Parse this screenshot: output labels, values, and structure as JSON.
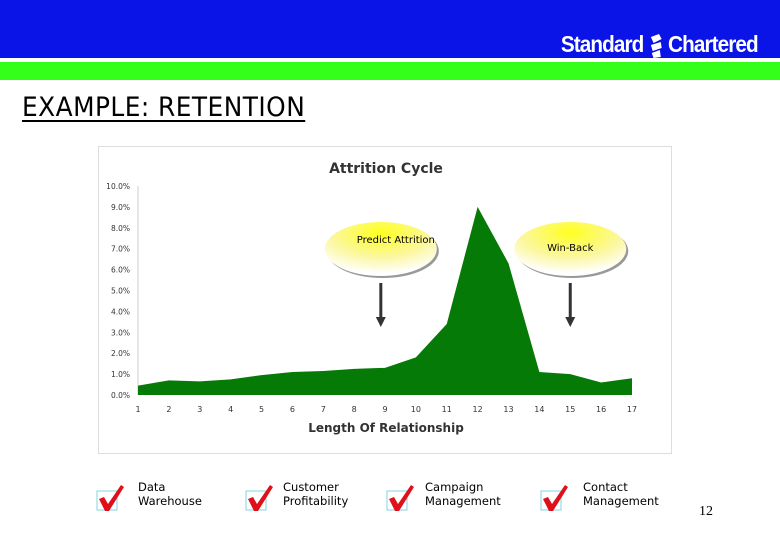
{
  "header": {
    "brand": "Standard Chartered",
    "brand_blue": "#0a14e6",
    "brand_green": "#33ff1a"
  },
  "slide": {
    "title": "EXAMPLE: RETENTION",
    "page_number": "12"
  },
  "chart_data": {
    "type": "area",
    "title": "Attrition Cycle",
    "xlabel": "Length Of Relationship",
    "ylabel": "",
    "x": [
      1,
      2,
      3,
      4,
      5,
      6,
      7,
      8,
      9,
      10,
      11,
      12,
      13,
      14,
      15,
      16,
      17
    ],
    "values": [
      0.45,
      0.7,
      0.65,
      0.75,
      0.95,
      1.1,
      1.15,
      1.25,
      1.3,
      1.8,
      3.4,
      9.0,
      6.3,
      1.1,
      1.0,
      0.6,
      0.8
    ],
    "ylim": [
      0,
      10
    ],
    "yticks": [
      "0.0%",
      "1.0%",
      "2.0%",
      "3.0%",
      "4.0%",
      "5.0%",
      "6.0%",
      "7.0%",
      "8.0%",
      "9.0%",
      "10.0%"
    ],
    "color": "#067a06",
    "grid": false,
    "annotations": [
      {
        "text": "Predict Attrition",
        "x": 8.8
      },
      {
        "text": "Win-Back",
        "x": 15
      }
    ]
  },
  "checklist": [
    {
      "line1": "Data",
      "line2": "Warehouse"
    },
    {
      "line1": "Customer",
      "line2": "Profitability"
    },
    {
      "line1": "Campaign",
      "line2": "Management"
    },
    {
      "line1": "Contact",
      "line2": "Management"
    }
  ]
}
